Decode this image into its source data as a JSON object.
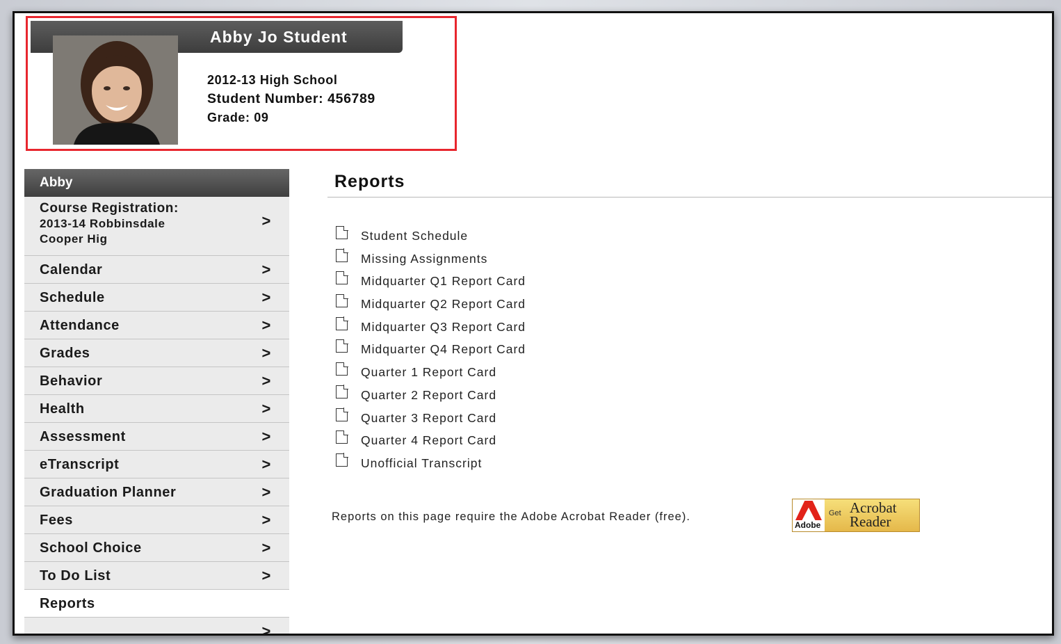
{
  "student": {
    "name": "Abby Jo Student",
    "year_school": "2012-13 High School",
    "student_number": "Student Number: 456789",
    "grade": "Grade: 09"
  },
  "sidebar": {
    "header": "Abby",
    "items": [
      {
        "label": "Course Registration:",
        "sub1": "2013-14 Robbinsdale",
        "sub2": "Cooper Hig",
        "chevron": ">"
      },
      {
        "label": "Calendar",
        "chevron": ">"
      },
      {
        "label": "Schedule",
        "chevron": ">"
      },
      {
        "label": "Attendance",
        "chevron": ">"
      },
      {
        "label": "Grades",
        "chevron": ">"
      },
      {
        "label": "Behavior",
        "chevron": ">"
      },
      {
        "label": "Health",
        "chevron": ">"
      },
      {
        "label": "Assessment",
        "chevron": ">"
      },
      {
        "label": "eTranscript",
        "chevron": ">"
      },
      {
        "label": "Graduation Planner",
        "chevron": ">"
      },
      {
        "label": "Fees",
        "chevron": ">"
      },
      {
        "label": "School Choice",
        "chevron": ">"
      },
      {
        "label": "To Do List",
        "chevron": ">"
      },
      {
        "label": "Reports"
      },
      {
        "label": "",
        "chevron": ">"
      }
    ]
  },
  "main": {
    "title": "Reports",
    "reports": [
      "Student Schedule",
      "Missing Assignments",
      "Midquarter Q1 Report Card",
      "Midquarter Q2 Report Card",
      "Midquarter Q3 Report Card",
      "Midquarter Q4 Report Card",
      "Quarter 1 Report Card",
      "Quarter 2 Report Card",
      "Quarter 3 Report Card",
      "Quarter 4 Report Card",
      "Unofficial Transcript"
    ],
    "note": "Reports on this page require the Adobe Acrobat Reader (free).",
    "acrobat": {
      "logo": "Adobe",
      "get": "Get",
      "line1": "Acrobat",
      "line2": "Reader"
    }
  },
  "colors": {
    "highlight": "#e8262e",
    "header_bar": "#4a4a4a",
    "nav_bg": "#ebebeb"
  }
}
